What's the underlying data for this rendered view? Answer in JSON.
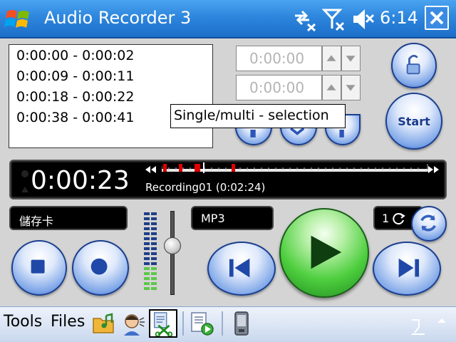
{
  "title_bar": {
    "app_title": "Audio Recorder 3",
    "clock": "6:14",
    "icons": [
      "windows-start-icon",
      "connectivity-off-icon",
      "signal-off-icon",
      "speaker-muted-icon",
      "close-icon"
    ]
  },
  "selection_list": {
    "items": [
      "0:00:00 - 0:00:02",
      "0:00:09 - 0:00:11",
      "0:00:18 - 0:00:22",
      "0:00:38 - 0:00:41"
    ]
  },
  "time_spinners": {
    "start_value": "0:00:00",
    "end_value": "0:00:00"
  },
  "tooltip": "Single/multi - selection",
  "start_button_label": "Start",
  "display": {
    "timecode": "0:00:23",
    "recording_name": "Recording01 (0:02:24)",
    "marker_color": "#e00000"
  },
  "storage_label": "儲存卡",
  "format_label": "MP3",
  "repeat_count": "1",
  "bottom_bar": {
    "menu_tools": "Tools",
    "menu_files": "Files"
  },
  "colors": {
    "titlebar": "#2e86dd",
    "play_green": "#2fb82f",
    "button_blue": "#2f63c4"
  }
}
